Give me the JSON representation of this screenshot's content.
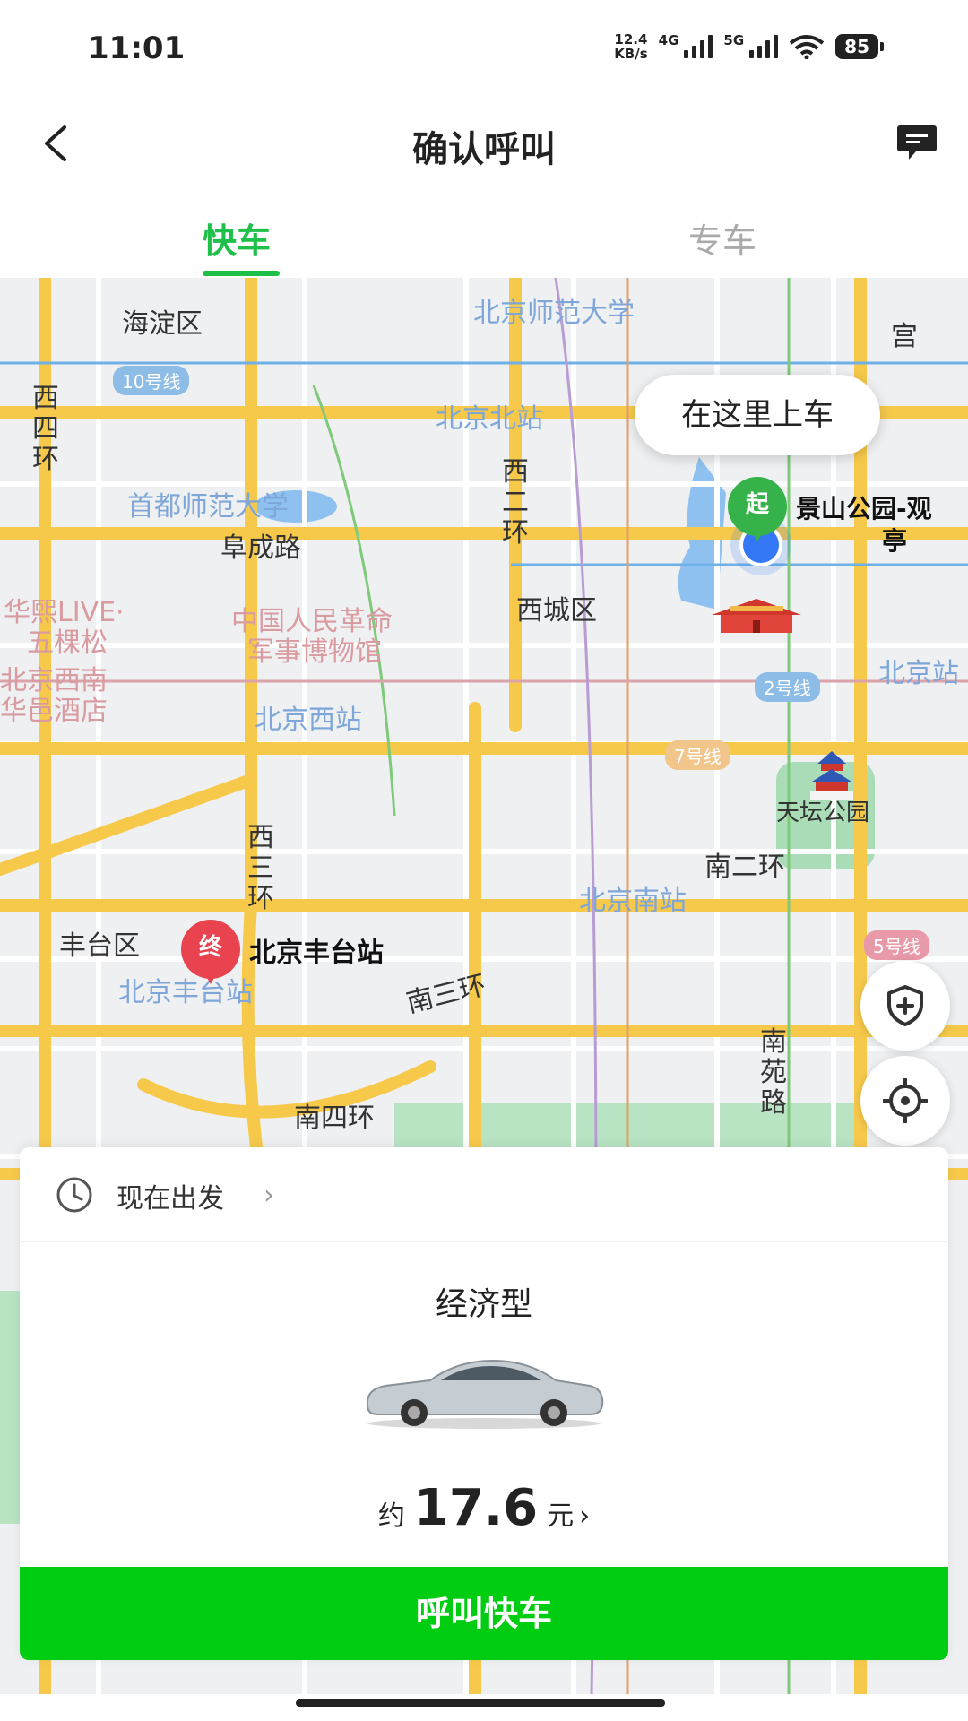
{
  "status_bar": {
    "time": "11:01",
    "net_speed_value": "12.4",
    "net_speed_unit": "KB/s",
    "sig1": "4G",
    "sig2": "5G",
    "battery": "85"
  },
  "header": {
    "title": "确认呼叫"
  },
  "tabs": [
    {
      "label": "快车",
      "active": true
    },
    {
      "label": "专车",
      "active": false
    }
  ],
  "map": {
    "labels": {
      "haidian": "海淀区",
      "bnu": "北京师范大学",
      "line10": "10号线",
      "xisihuan": "西四环",
      "beijingbei": "北京北站",
      "xierhuan": "西二环",
      "cnu": "首都师范大学",
      "fuchenglu": "阜成路",
      "xicheng": "西城区",
      "museum1": "中国人民革命",
      "museum2": "军事博物馆",
      "huaxi1": "华熙LIVE·",
      "huaxi2": "五棵松",
      "xinan1": "北京西南",
      "xinan2": "华邑酒店",
      "beijingxi": "北京西站",
      "line2": "2号线",
      "line7": "7号线",
      "beijingzhan": "北京站",
      "tiantan": "天坛公园",
      "nanerhuan": "南二环",
      "xisanhuan": "西三环",
      "beijingnan": "北京南站",
      "fengtai": "丰台区",
      "fengtaizhan_map": "北京丰台站",
      "nansanhuan": "南三环",
      "line5": "5号线",
      "nanyuanlu": "南苑路",
      "nansihuan": "南四环",
      "palace": "宫"
    },
    "pickup_bubble": "在这里上车",
    "start_pin": "起",
    "start_name_1": "景山公园-观",
    "start_name_2": "亭",
    "end_pin": "终",
    "end_name": "北京丰台站"
  },
  "depart": {
    "label": "现在出发"
  },
  "car": {
    "type": "经济型",
    "price_prefix": "约",
    "price": "17.6",
    "price_unit": "元"
  },
  "call_button": "呼叫快车",
  "colors": {
    "accent": "#1ec04a",
    "button": "#00cc11",
    "start": "#35b24a",
    "end": "#e8434e"
  }
}
